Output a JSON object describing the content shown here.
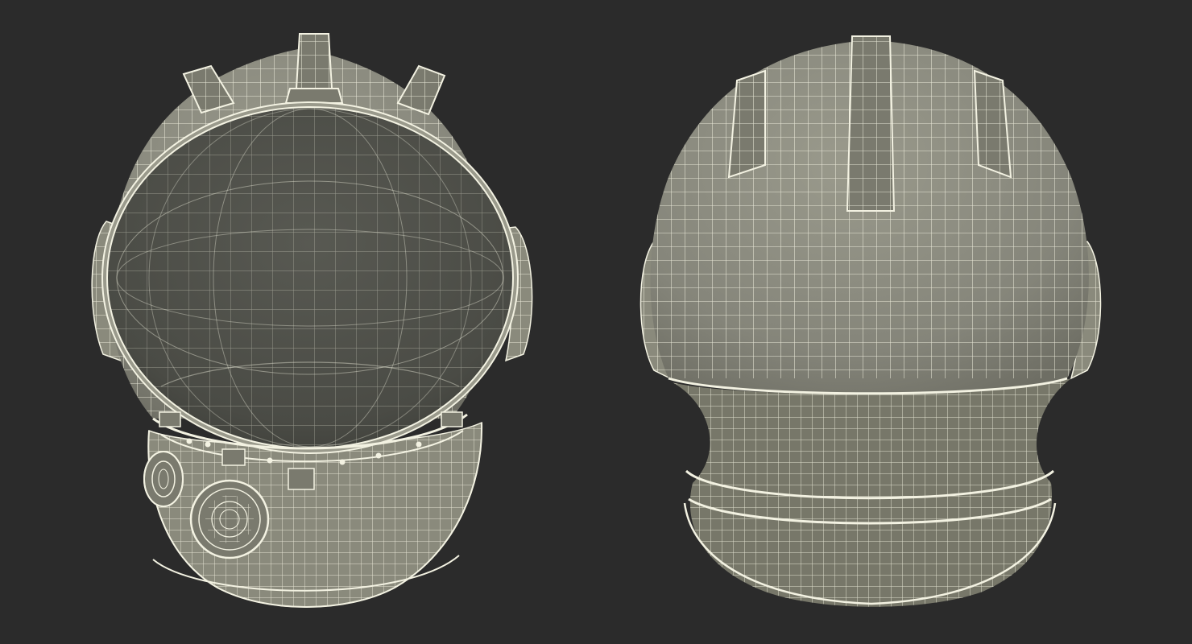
{
  "scene": {
    "background_color": "#2b2b2b",
    "shell_color": "#8a8a7c",
    "wire_color": "#f3f2e2",
    "visor_color": "#4e4f48",
    "neck_inner_color": "#777769"
  },
  "views": [
    {
      "view": "front",
      "features": [
        "visor",
        "ear-pad-left",
        "ear-pad-right",
        "neck-ring",
        "valve-large",
        "valve-small",
        "rivet-row"
      ]
    },
    {
      "view": "back",
      "features": [
        "top-ridge",
        "side-ridge-left",
        "side-ridge-right",
        "ear-pad-left",
        "ear-pad-right",
        "neck-collar"
      ]
    }
  ]
}
